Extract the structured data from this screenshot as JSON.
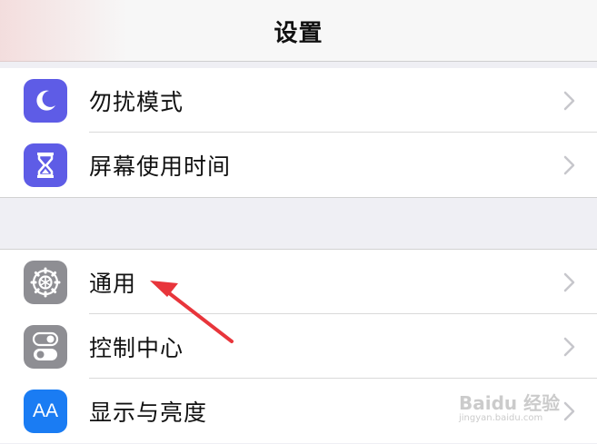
{
  "header": {
    "title": "设置"
  },
  "groups": [
    {
      "items": [
        {
          "label": "勿扰模式",
          "icon": "moon-icon",
          "icon_color": "#5e5ce6"
        },
        {
          "label": "屏幕使用时间",
          "icon": "hourglass-icon",
          "icon_color": "#5e5ce6"
        }
      ]
    },
    {
      "items": [
        {
          "label": "通用",
          "icon": "gear-icon",
          "icon_color": "#8e8e93"
        },
        {
          "label": "控制中心",
          "icon": "toggle-switches-icon",
          "icon_color": "#8e8e93"
        },
        {
          "label": "显示与亮度",
          "icon": "text-size-aa-icon",
          "icon_color": "#1a7cf3",
          "icon_text": "AA"
        }
      ]
    }
  ],
  "annotation": {
    "color": "#e8353b"
  },
  "watermark": {
    "text": "Baidu 经验",
    "subtext": "jingyan.baidu.com"
  }
}
